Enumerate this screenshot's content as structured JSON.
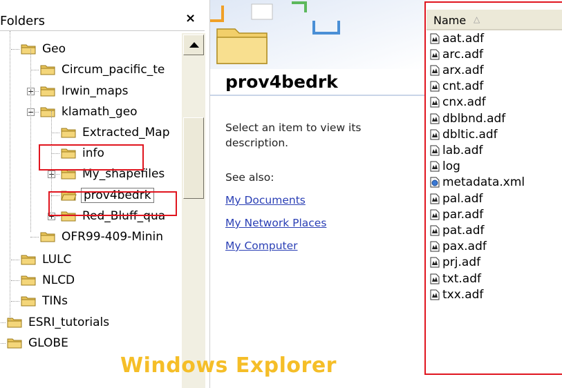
{
  "folders_pane": {
    "title": "Folders",
    "close_glyph": "×",
    "tree": [
      {
        "label": "Geo",
        "expander": "",
        "icon": "folder-icon"
      },
      {
        "label": "Circum_pacific_te",
        "expander": "",
        "icon": "folder-icon"
      },
      {
        "label": "Irwin_maps",
        "expander": "+",
        "icon": "folder-icon"
      },
      {
        "label": "klamath_geo",
        "expander": "−",
        "icon": "folder-icon"
      },
      {
        "label": "Extracted_Map",
        "expander": "",
        "icon": "folder-icon"
      },
      {
        "label": "info",
        "expander": "",
        "icon": "folder-icon"
      },
      {
        "label": "My_shapefiles",
        "expander": "+",
        "icon": "folder-icon"
      },
      {
        "label": "prov4bedrk",
        "expander": "",
        "icon": "open-folder-icon",
        "selected": true
      },
      {
        "label": "Red_Bluff_qua",
        "expander": "+",
        "icon": "folder-icon"
      },
      {
        "label": "OFR99-409-Minin",
        "expander": "",
        "icon": "folder-icon"
      },
      {
        "label": "LULC",
        "expander": "",
        "icon": "folder-icon"
      },
      {
        "label": "NLCD",
        "expander": "",
        "icon": "folder-icon"
      },
      {
        "label": "TINs",
        "expander": "",
        "icon": "folder-icon"
      },
      {
        "label": "ESRI_tutorials",
        "expander": "",
        "icon": "folder-icon"
      },
      {
        "label": "GLOBE",
        "expander": "",
        "icon": "folder-icon"
      }
    ]
  },
  "task_pane": {
    "folder_name": "prov4bedrk",
    "description": "Select an item to view its description.",
    "see_also_label": "See also:",
    "links": [
      "My Documents",
      "My Network Places",
      "My Computer"
    ]
  },
  "files_pane": {
    "column_header": "Name",
    "sort_indicator": "△",
    "files": [
      {
        "name": "aat.adf",
        "icon": "adf-file-icon"
      },
      {
        "name": "arc.adf",
        "icon": "adf-file-icon"
      },
      {
        "name": "arx.adf",
        "icon": "adf-file-icon"
      },
      {
        "name": "cnt.adf",
        "icon": "adf-file-icon"
      },
      {
        "name": "cnx.adf",
        "icon": "adf-file-icon"
      },
      {
        "name": "dblbnd.adf",
        "icon": "adf-file-icon"
      },
      {
        "name": "dbltic.adf",
        "icon": "adf-file-icon"
      },
      {
        "name": "lab.adf",
        "icon": "adf-file-icon"
      },
      {
        "name": "log",
        "icon": "adf-file-icon"
      },
      {
        "name": "metadata.xml",
        "icon": "xml-file-icon"
      },
      {
        "name": "pal.adf",
        "icon": "adf-file-icon"
      },
      {
        "name": "par.adf",
        "icon": "adf-file-icon"
      },
      {
        "name": "pat.adf",
        "icon": "adf-file-icon"
      },
      {
        "name": "pax.adf",
        "icon": "adf-file-icon"
      },
      {
        "name": "prj.adf",
        "icon": "adf-file-icon"
      },
      {
        "name": "txt.adf",
        "icon": "adf-file-icon"
      },
      {
        "name": "txx.adf",
        "icon": "adf-file-icon"
      }
    ]
  },
  "caption": "Windows Explorer",
  "colors": {
    "highlight_red": "#e0141e",
    "caption_yellow": "#f5be28",
    "link_blue": "#2a3fb5",
    "folder_yellow": "#f4d67a"
  }
}
